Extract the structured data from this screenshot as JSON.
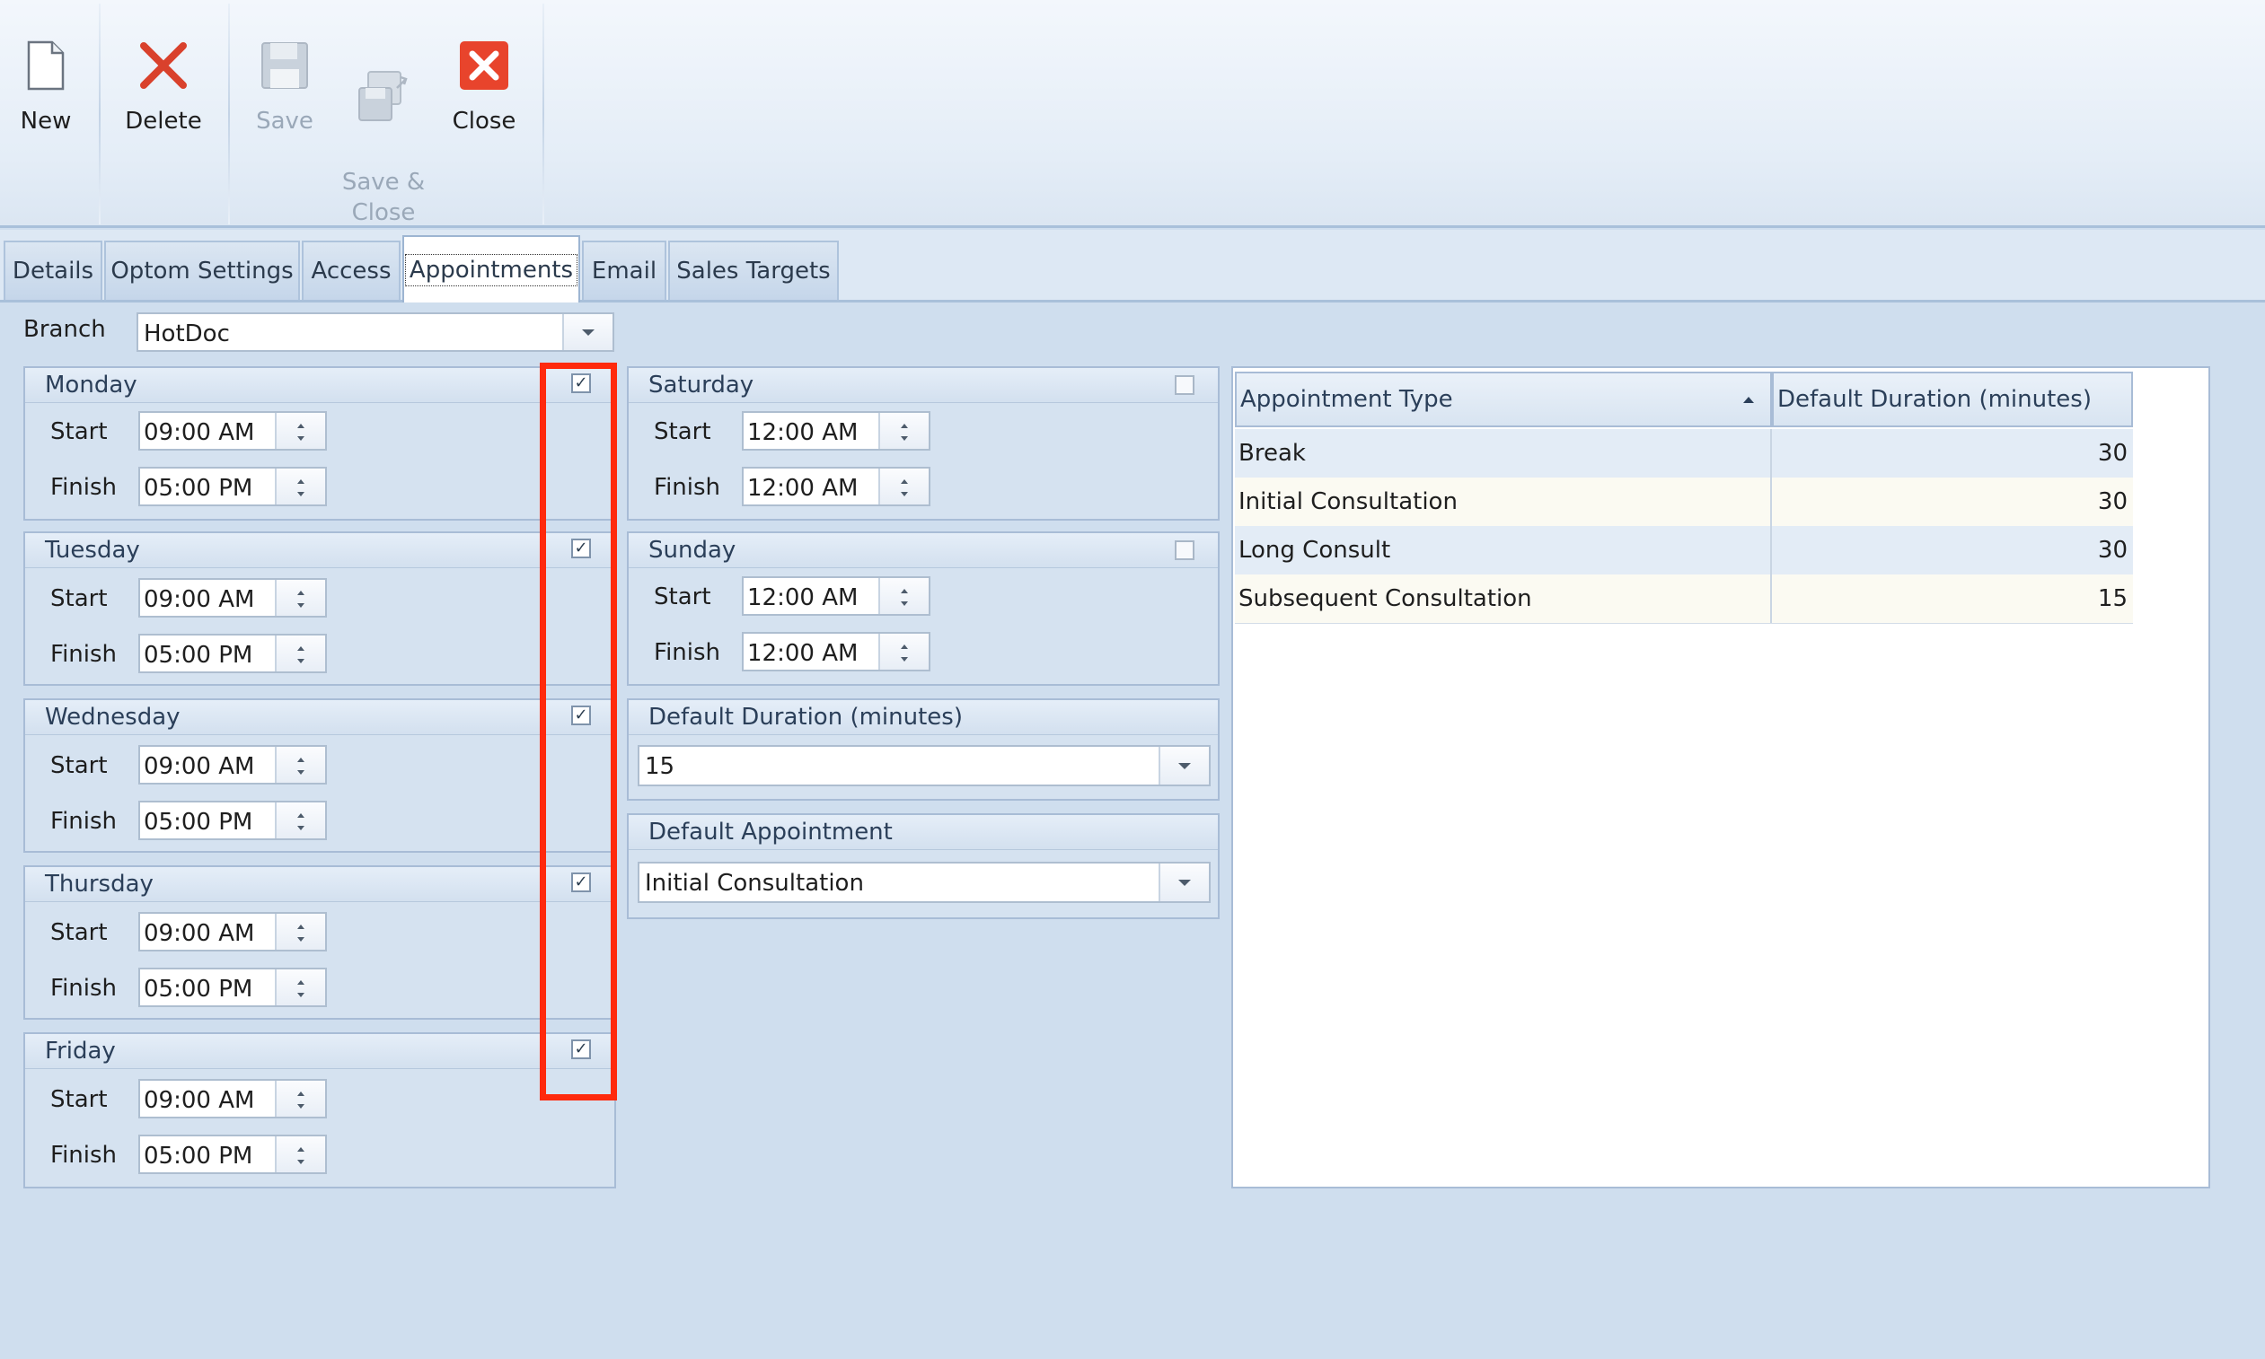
{
  "ribbon": {
    "new_label": "New",
    "delete_label": "Delete",
    "save_label": "Save",
    "save_close_label": "Save &\nClose",
    "close_label": "Close"
  },
  "tabs": [
    "Details",
    "Optom Settings",
    "Access",
    "Appointments",
    "Email",
    "Sales Targets"
  ],
  "branch": {
    "label": "Branch",
    "value": "HotDoc"
  },
  "labels": {
    "start": "Start",
    "finish": "Finish"
  },
  "days": [
    {
      "name": "Monday",
      "enabled": true,
      "start": "09:00 AM",
      "finish": "05:00 PM"
    },
    {
      "name": "Tuesday",
      "enabled": true,
      "start": "09:00 AM",
      "finish": "05:00 PM"
    },
    {
      "name": "Wednesday",
      "enabled": true,
      "start": "09:00 AM",
      "finish": "05:00 PM"
    },
    {
      "name": "Thursday",
      "enabled": true,
      "start": "09:00 AM",
      "finish": "05:00 PM"
    },
    {
      "name": "Friday",
      "enabled": true,
      "start": "09:00 AM",
      "finish": "05:00 PM"
    },
    {
      "name": "Saturday",
      "enabled": false,
      "start": "12:00 AM",
      "finish": "12:00 AM"
    },
    {
      "name": "Sunday",
      "enabled": false,
      "start": "12:00 AM",
      "finish": "12:00 AM"
    }
  ],
  "default_duration": {
    "title": "Default Duration (minutes)",
    "value": "15"
  },
  "default_appointment": {
    "title": "Default Appointment",
    "value": "Initial Consultation"
  },
  "grid": {
    "headers": [
      "Appointment Type",
      "Default Duration (minutes)"
    ],
    "rows": [
      {
        "type": "Break",
        "duration": "30"
      },
      {
        "type": "Initial Consultation",
        "duration": "30"
      },
      {
        "type": "Long Consult",
        "duration": "30"
      },
      {
        "type": "Subsequent Consultation",
        "duration": "15"
      }
    ]
  },
  "colors": {
    "highlight": "#ff2a0d",
    "close_icon": "#e8442c",
    "delete_icon": "#d9412c"
  }
}
